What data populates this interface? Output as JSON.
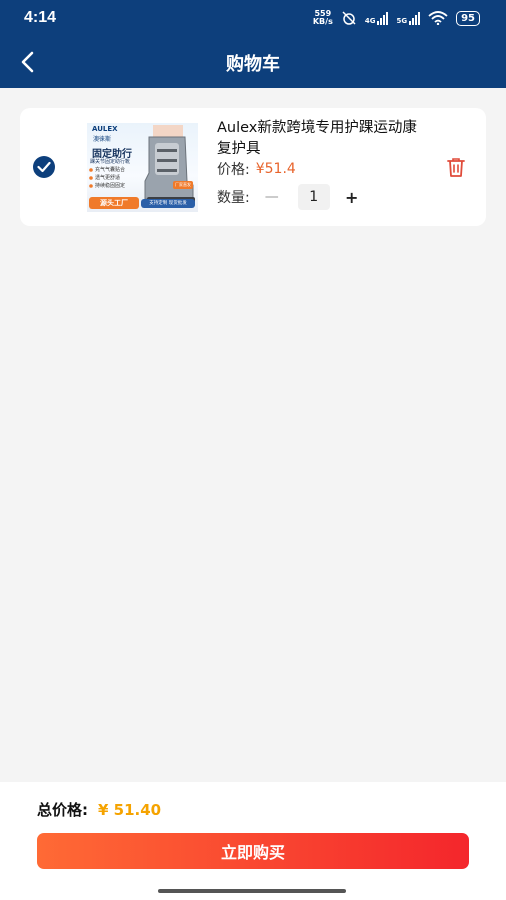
{
  "status_bar": {
    "time": "4:14",
    "net_speed_value": "559",
    "net_speed_unit": "KB/s",
    "signal_1": "4G",
    "signal_2": "5G",
    "battery": "95"
  },
  "nav": {
    "title": "购物车"
  },
  "cart_item": {
    "title": "Aulex新款跨境专用护踝运动康复护具",
    "price_label": "价格:",
    "price": "¥51.4",
    "qty_label": "数量:",
    "qty_minus": "—",
    "quantity": "1",
    "qty_plus": "+",
    "image": {
      "brand": "AULEX",
      "brand_cn": "澳徕斯",
      "headline": "固定助行",
      "subline": "踝关节固定助行靴",
      "features": [
        "充气气囊贴合",
        "透气更舒适",
        "持续稳固固定"
      ],
      "tag": "源头工厂",
      "tag2": "支持定制 现货批发",
      "stamp": "厂家直发"
    }
  },
  "footer": {
    "total_label": "总价格:",
    "total_value": "¥ 51.40",
    "buy_label": "立即购买"
  },
  "colors": {
    "primary": "#0d3f7c",
    "price": "#e8642c",
    "total": "#f5a300",
    "button_start": "#ff6a35",
    "button_end": "#f4262c"
  }
}
